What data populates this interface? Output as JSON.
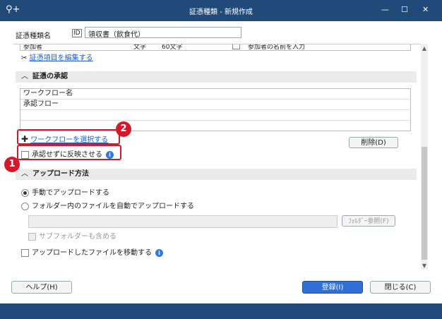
{
  "window": {
    "title": "証憑種類 - 新規作成"
  },
  "form": {
    "name_label": "証憑種類名",
    "name_value": "領収書（飲食代）"
  },
  "prev_row": {
    "col1": "参加者",
    "col2": "文字",
    "col3": "60文字",
    "col4": "参加者の名前を入力"
  },
  "items": {
    "edit_link": "証憑項目を編集する"
  },
  "approval": {
    "section_title": "証憑の承認",
    "table_header": "ワークフロー名",
    "rows": [
      "承認フロー"
    ],
    "select_link": "ワークフローを選択する",
    "delete_button": "削除(D)",
    "skip_checkbox": "承認せずに反映させる"
  },
  "upload": {
    "section_title": "アップロード方法",
    "manual": "手動でアップロードする",
    "auto": "フォルダー内のファイルを自動でアップロードする",
    "folder_button": "ﾌｫﾙﾀﾞｰ参照(F)",
    "subfolder": "サブフォルダーも含める",
    "move_files": "アップロードしたファイルを移動する"
  },
  "footer": {
    "help": "ヘルプ(H)",
    "register": "登録(I)",
    "close": "閉じる(C)"
  },
  "badges": {
    "one": "1",
    "two": "2"
  }
}
